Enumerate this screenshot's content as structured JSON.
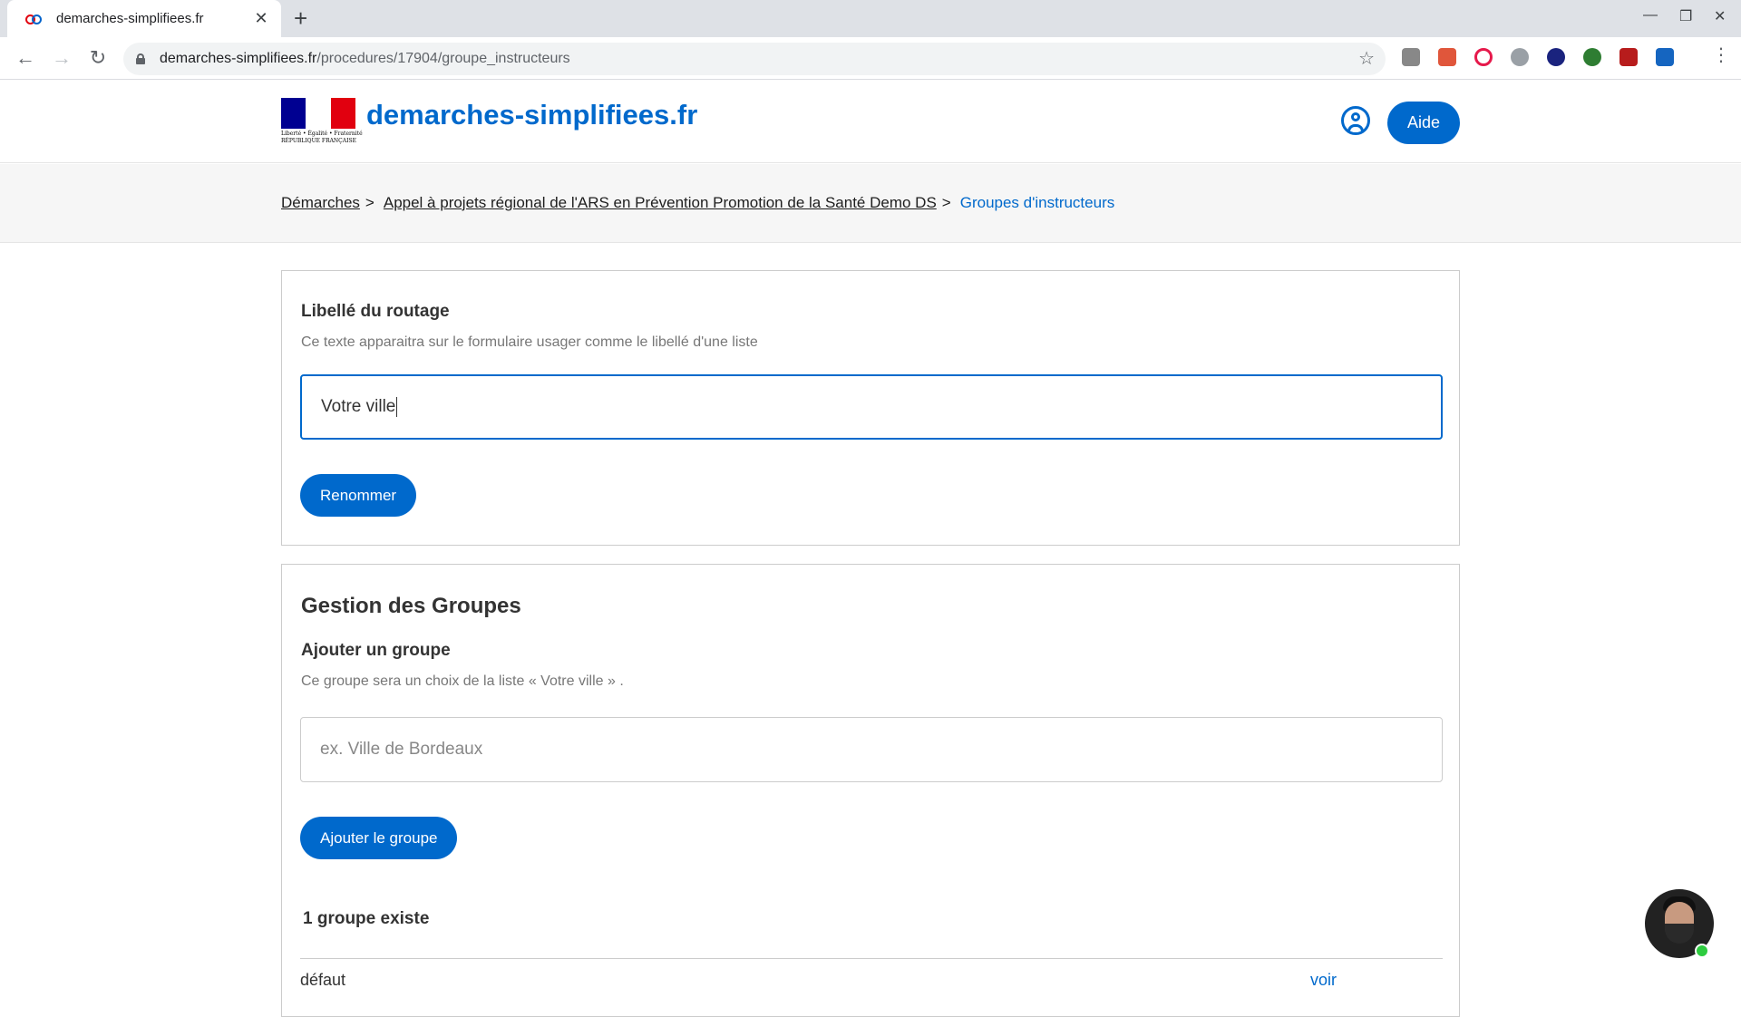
{
  "browser": {
    "tab_title": "demarches-simplifiees.fr",
    "url_host": "demarches-simplifiees.fr",
    "url_path": "/procedures/17904/groupe_instructeurs"
  },
  "header": {
    "logo_caption_1": "Liberté • Égalité • Fraternité",
    "logo_caption_2": "RÉPUBLIQUE FRANÇAISE",
    "site_title": "demarches-simplifiees.fr",
    "help_label": "Aide"
  },
  "breadcrumb": {
    "items": [
      {
        "label": "Démarches"
      },
      {
        "label": "Appel à projets régional de l'ARS en Prévention Promotion de la Santé Demo DS"
      }
    ],
    "current": "Groupes d'instructeurs",
    "separator": ">"
  },
  "routing": {
    "label": "Libellé du routage",
    "hint": "Ce texte apparaitra sur le formulaire usager comme le libellé d'une liste",
    "value": "Votre ville",
    "button": "Renommer"
  },
  "groups": {
    "title": "Gestion des Groupes",
    "add_label": "Ajouter un groupe",
    "add_hint": "Ce groupe sera un choix de la liste « Votre ville » .",
    "placeholder": "ex. Ville de Bordeaux",
    "add_button": "Ajouter le groupe",
    "count_text": "1 groupe existe",
    "rows": [
      {
        "name": "défaut",
        "action": "voir"
      }
    ]
  },
  "colors": {
    "accent": "#0069cc",
    "online": "#2ecc40"
  }
}
